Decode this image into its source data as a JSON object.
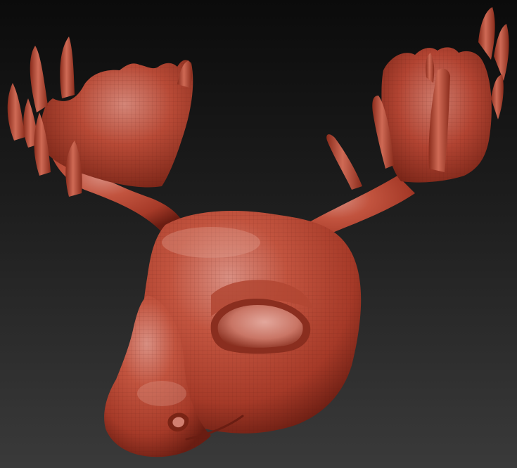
{
  "scene": {
    "subject_icon": "moose-head-icon",
    "material": {
      "base_color": "#b5432f",
      "highlight_color": "#d98f82",
      "shadow_color": "#6a1d12"
    },
    "background": {
      "top_color": "#0b0b0b",
      "bottom_color": "#3a3a3a"
    }
  }
}
